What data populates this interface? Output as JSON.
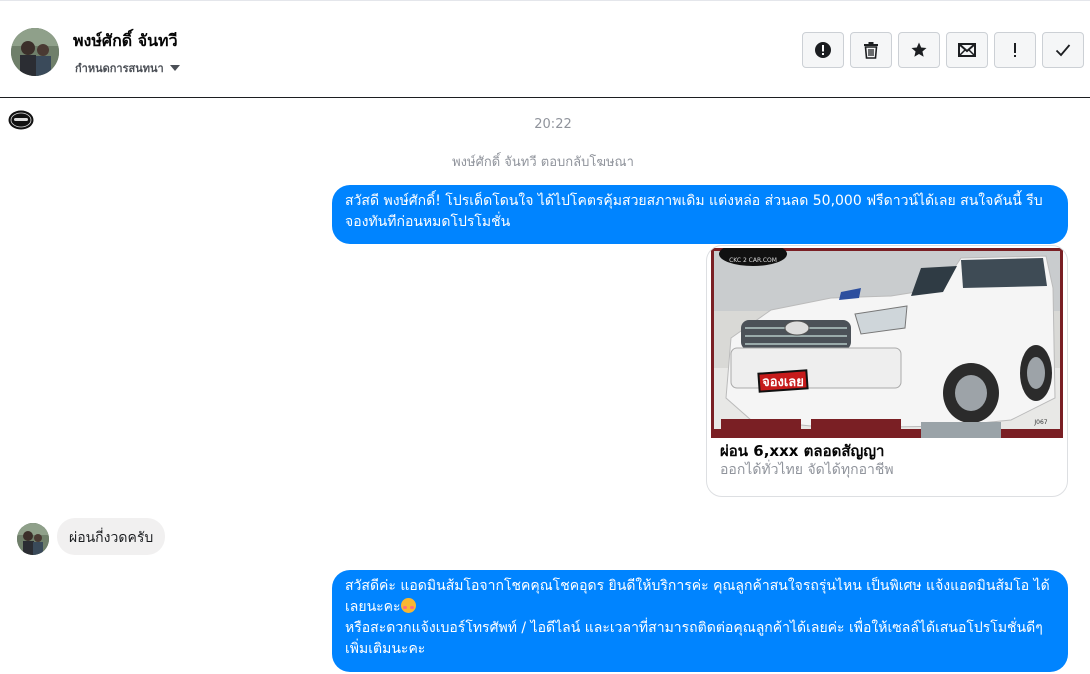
{
  "header": {
    "contact_name": "พงษ์ศักดิ์ จันทวี",
    "conversation_label": "กำหนดการสนทนา",
    "actions": [
      {
        "name": "spam-icon",
        "icon": "exclamation-circle"
      },
      {
        "name": "trash-icon",
        "icon": "trash"
      },
      {
        "name": "star-icon",
        "icon": "star"
      },
      {
        "name": "mail-icon",
        "icon": "envelope"
      },
      {
        "name": "important-icon",
        "icon": "exclamation"
      },
      {
        "name": "done-icon",
        "icon": "checkmark"
      }
    ]
  },
  "thread": {
    "time": "20:22",
    "reply_notice": "พงษ์ศักดิ์ จันทวี ตอบกลับโฆษณา",
    "messages": [
      {
        "direction": "outgoing",
        "text": "สวัสดี พงษ์ศักดิ์! โปรเด็ดโดนใจ ได้ไปโคตรคุ้มสวยสภาพเดิม แต่งหล่อ  ส่วนลด 50,000 ฟรีดาวน์ได้เลย  สนใจคันนี้ รีบจองทันทีก่อนหมดโปรโมชั่น"
      },
      {
        "direction": "outgoing",
        "type": "ad_card",
        "image_badge": "จองเลย",
        "image_code": "J067",
        "title": "ผ่อน 6,xxx ตลอดสัญญา",
        "subtitle": "ออกได้ทั่วไทย จัดได้ทุกอาชีพ"
      },
      {
        "direction": "incoming",
        "text": "ผ่อนกี่งวดครับ"
      },
      {
        "direction": "outgoing",
        "line1": "สวัสดีค่ะ แอดมินส้มโอจากโชคคุณโชคอุดร ยินดีให้บริการค่ะ   คุณลูกค้าสนใจรถรุ่นไหน เป็นพิเศษ แจ้งแอดมินส้มโอ ได้เลยนะคะ",
        "emoji": "smiling-face-with-hearts",
        "line2": "หรือสะดวกแจ้งเบอร์โทรศัพท์ / ไอดีไลน์ และเวลาที่สามารถติดต่อคุณลูกค้าได้เลยค่ะ เพื่อให้เซลล์ได้เสนอโปรโมชั่นดีๆเพิ่มเติมนะคะ"
      }
    ]
  },
  "colors": {
    "outgoing_bubble": "#0084ff",
    "incoming_bubble": "#f1f0f0",
    "meta_text": "#90949c"
  }
}
